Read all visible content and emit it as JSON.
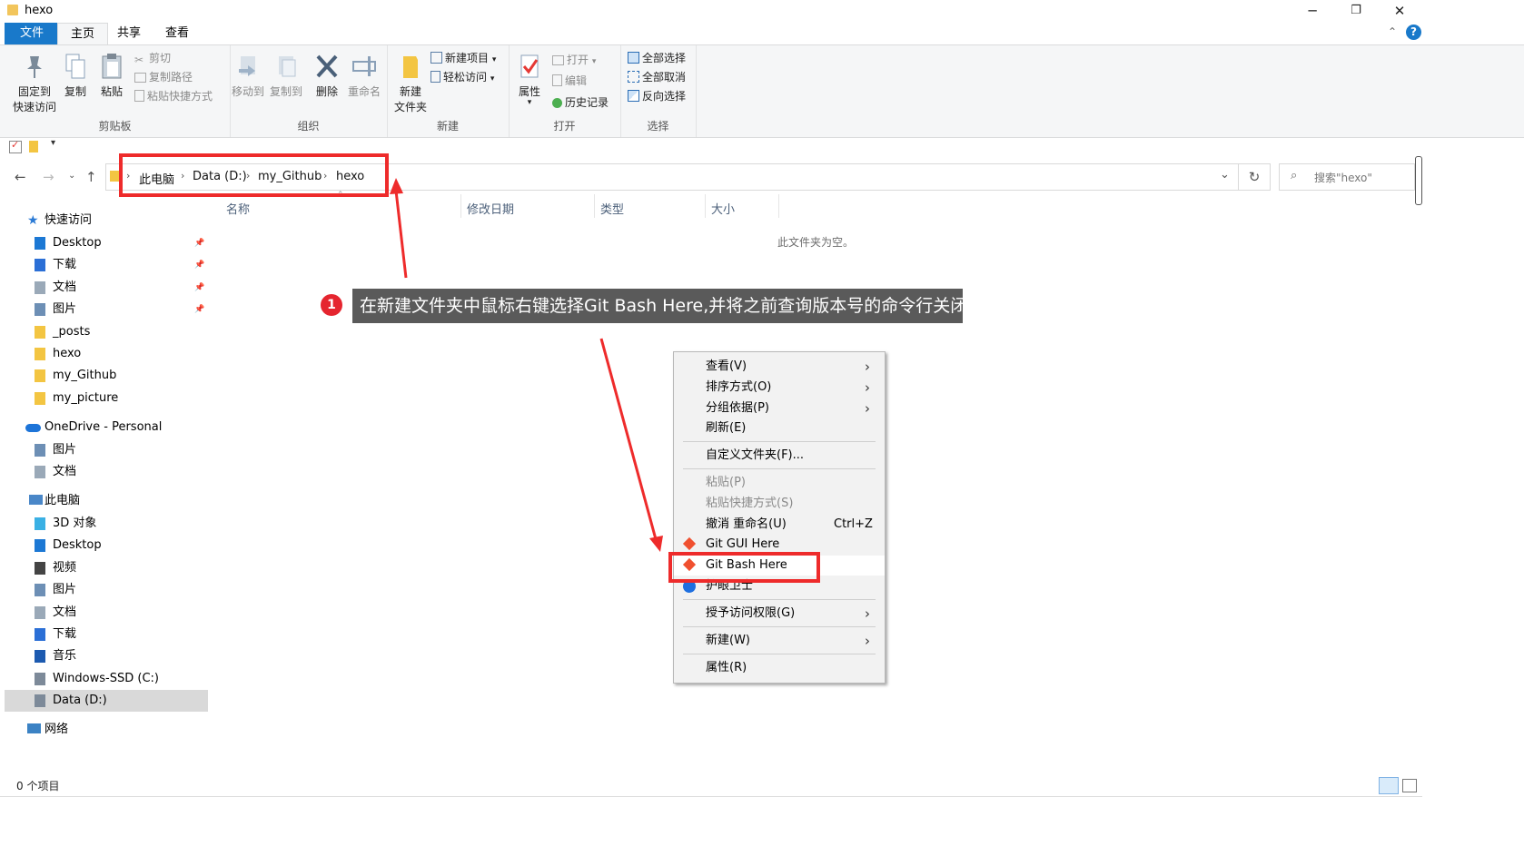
{
  "window": {
    "title": "hexo",
    "minimize": "─",
    "restore": "❐",
    "close": "✕"
  },
  "ribbon": {
    "tabs": [
      "文件",
      "主页",
      "共享",
      "查看"
    ],
    "clipboard": {
      "pin_label_1": "固定到",
      "pin_label_2": "快速访问",
      "copy": "复制",
      "paste": "粘贴",
      "cut": "剪切",
      "copy_path": "复制路径",
      "paste_shortcut": "粘贴快捷方式",
      "group": "剪贴板"
    },
    "organize": {
      "move_to": "移动到",
      "copy_to": "复制到",
      "delete": "删除",
      "rename": "重命名",
      "group": "组织"
    },
    "new": {
      "new_folder_1": "新建",
      "new_folder_2": "文件夹",
      "new_item": "新建项目",
      "easy_access": "轻松访问",
      "group": "新建"
    },
    "open": {
      "properties": "属性",
      "open": "打开",
      "edit": "编辑",
      "history": "历史记录",
      "group": "打开"
    },
    "select": {
      "select_all": "全部选择",
      "select_none": "全部取消",
      "invert": "反向选择",
      "group": "选择"
    }
  },
  "address": {
    "crumbs": [
      "此电脑",
      "Data (D:)",
      "my_Github",
      "hexo"
    ],
    "search_placeholder": "搜索\"hexo\""
  },
  "nav": {
    "quick_access": "快速访问",
    "quick_items": [
      "Desktop",
      "下载",
      "文档",
      "图片",
      "_posts",
      "hexo",
      "my_Github",
      "my_picture"
    ],
    "onedrive": "OneDrive - Personal",
    "onedrive_items": [
      "图片",
      "文档"
    ],
    "this_pc": "此电脑",
    "pc_items": [
      "3D 对象",
      "Desktop",
      "视频",
      "图片",
      "文档",
      "下载",
      "音乐",
      "Windows-SSD (C:)",
      "Data (D:)"
    ],
    "network": "网络"
  },
  "columns": [
    "名称",
    "修改日期",
    "类型",
    "大小"
  ],
  "empty_message": "此文件夹为空。",
  "status": "0 个项目",
  "context_menu": {
    "view": "查看(V)",
    "sort": "排序方式(O)",
    "group_by": "分组依据(P)",
    "refresh": "刷新(E)",
    "customize": "自定义文件夹(F)...",
    "paste": "粘贴(P)",
    "paste_shortcut": "粘贴快捷方式(S)",
    "undo": "撤消 重命名(U)",
    "undo_shortcut": "Ctrl+Z",
    "git_gui": "Git GUI Here",
    "git_bash": "Git Bash Here",
    "eye_guard": "护眼卫士",
    "grant_access": "授予访问权限(G)",
    "new": "新建(W)",
    "properties": "属性(R)"
  },
  "annotation": {
    "step": "1",
    "text": "在新建文件夹中鼠标右键选择Git Bash Here,并将之前查询版本号的命令行关闭"
  },
  "colors": {
    "accent": "#1979ca",
    "highlight_red": "#ee2b2b",
    "callout_bg": "#5a5a5a"
  }
}
